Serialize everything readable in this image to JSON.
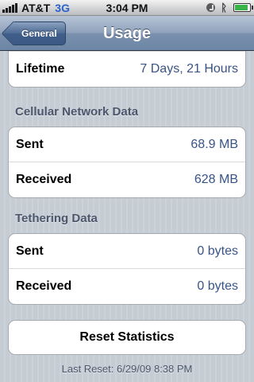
{
  "status_bar": {
    "carrier": "AT&T",
    "network": "3G",
    "time": "3:04 PM",
    "bluetooth_icon": "bluetooth-icon",
    "lock_icon": "rotation-lock-icon",
    "battery_icon": "battery-icon",
    "battery_color": "#37b34a",
    "network_color": "#2a62c9"
  },
  "nav": {
    "back_label": "General",
    "title": "Usage"
  },
  "usage": {
    "lifetime": {
      "label": "Lifetime",
      "value": "7 Days, 21 Hours"
    }
  },
  "cellular": {
    "header": "Cellular Network Data",
    "rows": [
      {
        "label": "Sent",
        "value": "68.9 MB"
      },
      {
        "label": "Received",
        "value": "628 MB"
      }
    ]
  },
  "tethering": {
    "header": "Tethering Data",
    "rows": [
      {
        "label": "Sent",
        "value": "0 bytes"
      },
      {
        "label": "Received",
        "value": "0 bytes"
      }
    ]
  },
  "reset": {
    "button_label": "Reset Statistics",
    "last_reset": "Last Reset: 6/29/09 8:38 PM"
  },
  "colors": {
    "value_text": "#385487",
    "section_header": "#4c566c",
    "background": "#c5ccd4"
  }
}
